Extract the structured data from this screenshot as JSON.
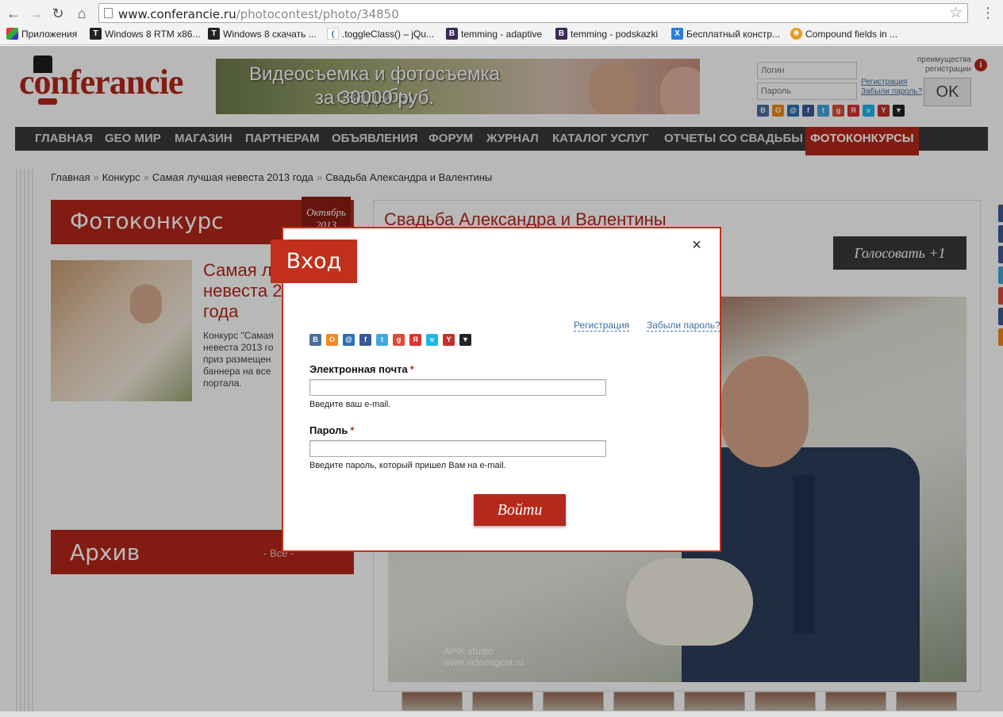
{
  "browser": {
    "url_host": "www.conferancie.ru",
    "url_path": "/photocontest/photo/34850",
    "bookmarks": [
      {
        "label": "Приложения",
        "icon": "apps-icon",
        "color": "#e44"
      },
      {
        "label": "Windows 8 RTM x86...",
        "icon": "t-icon",
        "color": "#222"
      },
      {
        "label": "Windows 8 скачать ...",
        "icon": "t-icon",
        "color": "#222"
      },
      {
        "label": ".toggleClass() – jQu...",
        "icon": "jquery-icon",
        "color": "#fff"
      },
      {
        "label": "temming - adaptive",
        "icon": "b-icon",
        "color": "#3a2a55"
      },
      {
        "label": "temming - podskazki",
        "icon": "b-icon",
        "color": "#3a2a55"
      },
      {
        "label": "Бесплатный констр...",
        "icon": "x-icon",
        "color": "#2a7fd4"
      },
      {
        "label": "Compound fields in ...",
        "icon": "sun-icon",
        "color": "#e89a1c"
      }
    ]
  },
  "header": {
    "logo": "conferancie",
    "banner_line1": "Видеосъемка и фотосъемка свадьбы",
    "banner_line2": "за 30000 руб.",
    "login_placeholder": "Логин",
    "password_placeholder": "Пароль",
    "register_link": "Регистрация",
    "forgot_link": "Забыли пароль?",
    "ok_label": "OK",
    "perks_line1": "преимущества",
    "perks_line2": "регистрации",
    "perks_icon": "i"
  },
  "nav": [
    {
      "label": "ГЛАВНАЯ",
      "active": false
    },
    {
      "label": "GEO МИР",
      "active": false
    },
    {
      "label": "МАГАЗИН",
      "active": false
    },
    {
      "label": "ПАРТНЕРАМ",
      "active": false
    },
    {
      "label": "ОБЪЯВЛЕНИЯ",
      "active": false
    },
    {
      "label": "ФОРУМ",
      "active": false
    },
    {
      "label": "ЖУРНАЛ",
      "active": false
    },
    {
      "label": "КАТАЛОГ УСЛУГ",
      "active": false
    },
    {
      "label": "ОТЧЕТЫ СО СВАДЬБЫ",
      "active": false
    },
    {
      "label": "ФОТОКОНКУРСЫ",
      "active": true
    }
  ],
  "breadcrumbs": [
    "Главная",
    "Конкурс",
    "Самая лучшая невеста 2013 года",
    "Свадьба Александра и Валентины"
  ],
  "left": {
    "contest_heading": "Фотоконкурс",
    "month_line1": "Октябрь",
    "month_line2": "2013",
    "contest_title": "Самая лучшая невеста 2013 года",
    "contest_title_visible": "Самая л невеста 2 года",
    "contest_desc": "Конкурс \"Самая невеста 2013 го приз размещен баннера на все портала.",
    "archive_heading": "Архив",
    "archive_filter": "- Все -"
  },
  "main": {
    "photo_title": "Свадьба Александра и Валентины",
    "vote_label": "Голосовать +1",
    "watermark1": "APIK studio",
    "watermark2": "www.videoagent.ru"
  },
  "modal": {
    "title": "Вход",
    "close": "×",
    "register_link": "Регистрация",
    "forgot_link": "Забыли пароль?",
    "email_label": "Электронная почта",
    "email_hint": "Введите ваш e-mail.",
    "password_label": "Пароль",
    "password_hint": "Введите пароль, который пришел Вам на e-mail.",
    "required_mark": "*",
    "submit_label": "Войти",
    "social": [
      {
        "name": "vkontakte-icon",
        "glyph": "B",
        "color": "#4a6f9e"
      },
      {
        "name": "odnoklassniki-icon",
        "glyph": "O",
        "color": "#f28a1c"
      },
      {
        "name": "mailru-icon",
        "glyph": "@",
        "color": "#2d6fb5"
      },
      {
        "name": "facebook-icon",
        "glyph": "f",
        "color": "#3b5998"
      },
      {
        "name": "twitter-icon",
        "glyph": "t",
        "color": "#40a7de"
      },
      {
        "name": "google-icon",
        "glyph": "g",
        "color": "#dd4b39"
      },
      {
        "name": "yandex-icon",
        "glyph": "Я",
        "color": "#e03030"
      },
      {
        "name": "vimeo-icon",
        "glyph": "v",
        "color": "#1ab7ea"
      },
      {
        "name": "youtube-icon",
        "glyph": "Y",
        "color": "#c4302b"
      },
      {
        "name": "more-icon",
        "glyph": "▼",
        "color": "#222"
      }
    ]
  }
}
